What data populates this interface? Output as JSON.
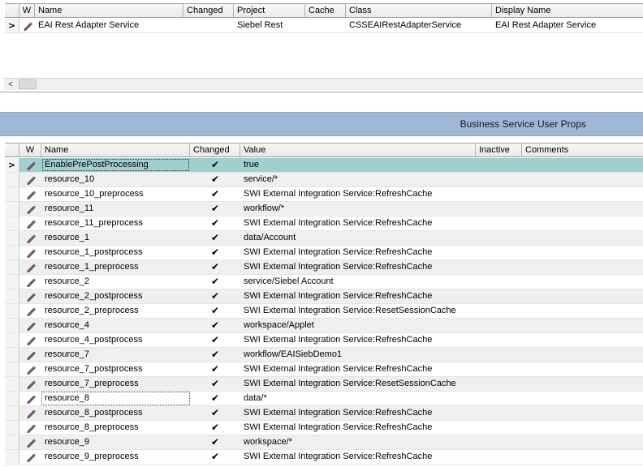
{
  "business_service": {
    "columns": {
      "w": "W",
      "name": "Name",
      "changed": "Changed",
      "project": "Project",
      "cache": "Cache",
      "class": "Class",
      "display": "Display Name"
    },
    "rows": [
      {
        "name": "EAI Rest Adapter Service",
        "changed": "",
        "project": "Siebel Rest",
        "cache": "",
        "class": "CSSEAIRestAdapterService",
        "display": "EAI Rest Adapter Service"
      }
    ],
    "current_row_icon": "current-record-arrow-icon",
    "edit_icon": "pencil-icon"
  },
  "applet_title": "Business Service User Props",
  "user_props": {
    "columns": {
      "w": "W",
      "name": "Name",
      "changed": "Changed",
      "value": "Value",
      "inactive": "Inactive",
      "comments": "Comments"
    },
    "check_mark": "✔",
    "rows": [
      {
        "name": "EnablePrePostProcessing",
        "changed": true,
        "value": "true"
      },
      {
        "name": "resource_10",
        "changed": true,
        "value": "service/*"
      },
      {
        "name": "resource_10_preprocess",
        "changed": true,
        "value": "SWI External Integration Service:RefreshCache"
      },
      {
        "name": "resource_11",
        "changed": true,
        "value": "workflow/*"
      },
      {
        "name": "resource_11_preprocess",
        "changed": true,
        "value": "SWI External Integration Service:RefreshCache"
      },
      {
        "name": "resource_1",
        "changed": true,
        "value": "data/Account"
      },
      {
        "name": "resource_1_postprocess",
        "changed": true,
        "value": "SWI External Integration Service:RefreshCache"
      },
      {
        "name": "resource_1_preprocess",
        "changed": true,
        "value": "SWI External Integration Service:RefreshCache"
      },
      {
        "name": "resource_2",
        "changed": true,
        "value": "service/Siebel Account"
      },
      {
        "name": "resource_2_postprocess",
        "changed": true,
        "value": "SWI External Integration Service:RefreshCache"
      },
      {
        "name": "resource_2_preprocess",
        "changed": true,
        "value": "SWI External Integration Service:ResetSessionCache"
      },
      {
        "name": "resource_4",
        "changed": true,
        "value": "workspace/Applet"
      },
      {
        "name": "resource_4_postprocess",
        "changed": true,
        "value": "SWI External Integration Service:RefreshCache"
      },
      {
        "name": "resource_7",
        "changed": true,
        "value": "workflow/EAISiebDemo1"
      },
      {
        "name": "resource_7_postprocess",
        "changed": true,
        "value": "SWI External Integration Service:RefreshCache"
      },
      {
        "name": "resource_7_preprocess",
        "changed": true,
        "value": "SWI External Integration Service:ResetSessionCache"
      },
      {
        "name": "resource_8",
        "changed": true,
        "value": "data/*"
      },
      {
        "name": "resource_8_postprocess",
        "changed": true,
        "value": "SWI External Integration Service:RefreshCache"
      },
      {
        "name": "resource_8_preprocess",
        "changed": true,
        "value": "SWI External Integration Service:RefreshCache"
      },
      {
        "name": "resource_9",
        "changed": true,
        "value": "workspace/*"
      },
      {
        "name": "resource_9_preprocess",
        "changed": true,
        "value": "SWI External Integration Service:RefreshCache"
      }
    ],
    "active_row": 0,
    "dotted_row": 16,
    "colors": {
      "active_row": "#9fcfcf",
      "title_bar": "#9fb6d4"
    }
  }
}
